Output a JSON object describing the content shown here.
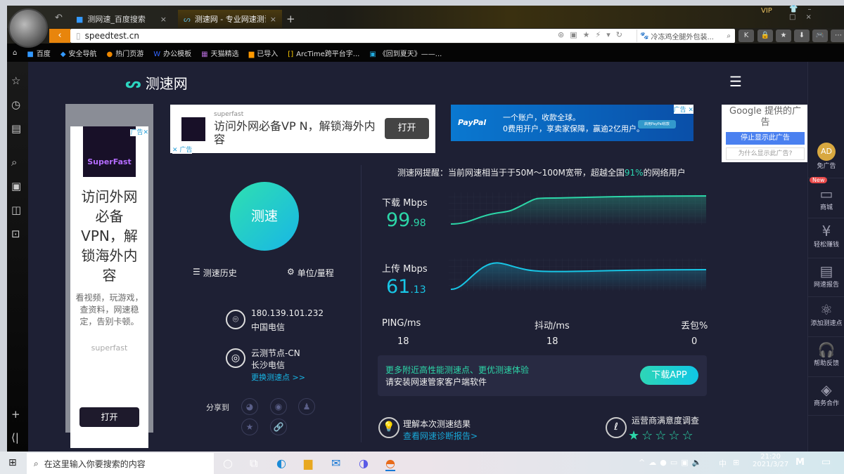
{
  "browser": {
    "tabs": [
      {
        "label": "测网速_百度搜索"
      },
      {
        "label": "测速网 - 专业网速测试"
      }
    ],
    "url": "speedtest.cn",
    "search_value": "冷冻鸡全腿外包装...",
    "vip": "VIP",
    "bookmarks": [
      "百度",
      "安全导航",
      "热门页游",
      "办公模板",
      "天猫精选",
      "已导入",
      "ArcTime跨平台字...",
      "《回到夏天》——..."
    ]
  },
  "site": {
    "name": "测速网"
  },
  "ads": {
    "left": {
      "tag": "广告",
      "brand_logo": "SuperFast",
      "headline": "访问外网必备VPN，解锁海外内容",
      "body": "看视频，玩游戏，查资料，网速稳定，告别卡顿。",
      "brand": "superfast",
      "button": "打开"
    },
    "top": {
      "brand": "superfast",
      "headline": "访问外网必备VP N，解锁海外内容",
      "button": "打开",
      "tag": "广告"
    },
    "paypal": {
      "brand": "PayPal",
      "line1": "一个账户，收款全球。",
      "line2": "0费用开户，享卖家保障，赢逾2亿用户。",
      "cta": "启用PayPal收款",
      "tag": "广告"
    },
    "google": {
      "title": "Google 提供的广告",
      "stop": "停止显示此广告",
      "why": "为什么显示此广告?"
    }
  },
  "test": {
    "start": "测速",
    "history": "测速历史",
    "units": "单位/量程",
    "ip": "180.139.101.232",
    "isp": "中国电信",
    "node": "云测节点-CN",
    "node_isp": "长沙电信",
    "change_node": "更换测速点 >>",
    "share_label": "分享到",
    "notice_prefix": "测速网提醒：当前网速相当于于50M～100M宽带，超越全国",
    "notice_pct": "91%",
    "notice_suffix": "的网络用户",
    "download_label": "下载 Mbps",
    "download_int": "99",
    "download_dec": ".98",
    "upload_label": "上传 Mbps",
    "upload_int": "61",
    "upload_dec": ".13",
    "ping_label": "PING/ms",
    "ping": "18",
    "jitter_label": "抖动/ms",
    "jitter": "18",
    "loss_label": "丢包%",
    "loss": "0",
    "promo_line1": "更多附近高性能测速点、更优测速体验",
    "promo_line2": "请安装网速管家客户端软件",
    "download_app": "下载APP",
    "understand": "理解本次测速结果",
    "diagnose": "查看网速诊断报告>",
    "survey": "运营商满意度调查",
    "rating": 1,
    "rating_max": 5
  },
  "right_sidebar": [
    {
      "label": "免广告"
    },
    {
      "label": "商城",
      "badge": "New"
    },
    {
      "label": "轻松赚钱"
    },
    {
      "label": "网速报告"
    },
    {
      "label": "添加测速点"
    },
    {
      "label": "帮助反馈"
    },
    {
      "label": "商务合作"
    }
  ],
  "taskbar": {
    "search_placeholder": "在这里输入你要搜索的内容",
    "time": "21:20",
    "date": "2021/3/27",
    "ime": "中"
  }
}
